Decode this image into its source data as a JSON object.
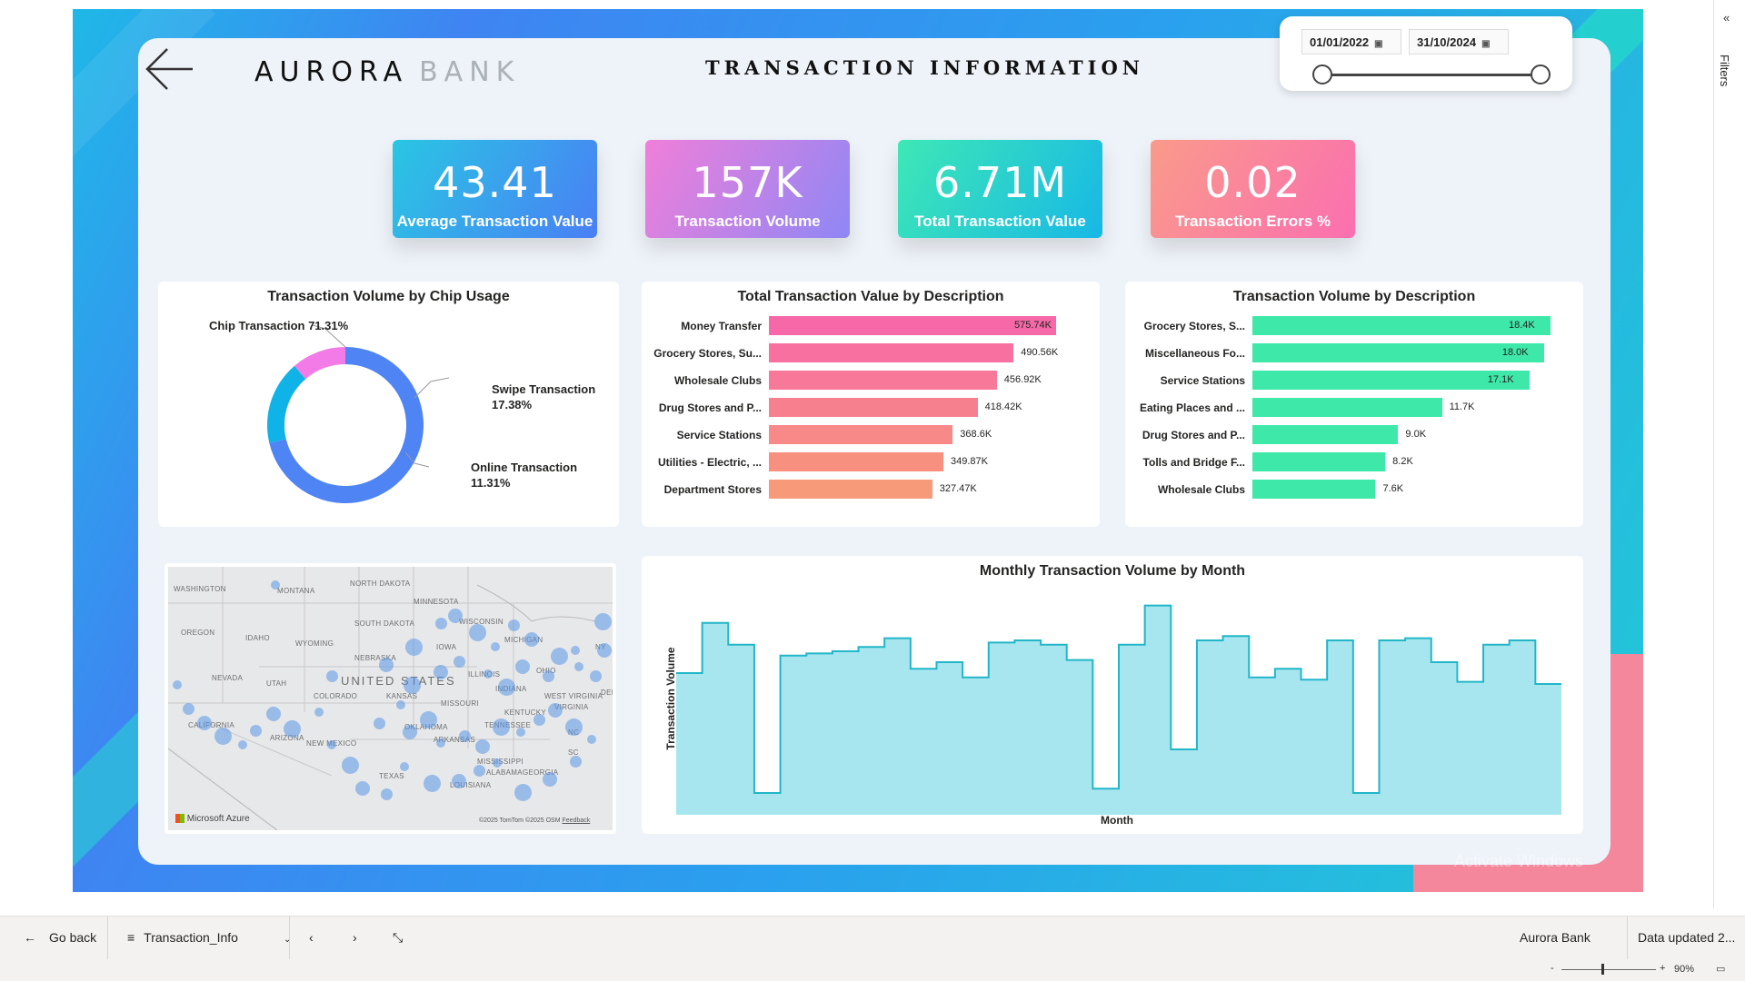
{
  "header": {
    "brand_primary": "AURORA",
    "brand_secondary": "BANK",
    "title": "TRANSACTION INFORMATION"
  },
  "date_slicer": {
    "start": "01/01/2022",
    "end": "31/10/2024"
  },
  "kpis": [
    {
      "value": "43.41",
      "label": "Average Transaction Value",
      "colors": [
        "#29c6e3",
        "#4a7ff5"
      ]
    },
    {
      "value": "157K",
      "label": "Transaction Volume",
      "colors": [
        "#f07fd9",
        "#8f87f5"
      ]
    },
    {
      "value": "6.71M",
      "label": "Total Transaction Value",
      "colors": [
        "#3ee8b5",
        "#17b8e6"
      ]
    },
    {
      "value": "0.02",
      "label": "Transaction Errors %",
      "colors": [
        "#f99a8a",
        "#fb6fb0"
      ]
    }
  ],
  "chip_usage": {
    "title": "Transaction Volume by Chip Usage",
    "chart_data": {
      "type": "pie",
      "categories": [
        "Chip Transaction",
        "Swipe Transaction",
        "Online Transaction"
      ],
      "values": [
        71.31,
        17.38,
        11.31
      ],
      "colors": [
        "#4f84f5",
        "#10b3e8",
        "#f27be7"
      ]
    },
    "labels": {
      "chip": "Chip Transaction 71.31%",
      "swipe_name": "Swipe Transaction",
      "swipe_pct": "17.38%",
      "online_name": "Online Transaction",
      "online_pct": "11.31%"
    }
  },
  "value_by_desc": {
    "title": "Total Transaction Value by Description",
    "chart_data": {
      "type": "bar",
      "categories": [
        "Money Transfer",
        "Grocery Stores, Su...",
        "Wholesale Clubs",
        "Drug Stores and P...",
        "Service Stations",
        "Utilities - Electric, ...",
        "Department Stores"
      ],
      "values": [
        575740,
        490560,
        456920,
        418420,
        368600,
        349870,
        327470
      ],
      "labels": [
        "575.74K",
        "490.56K",
        "456.92K",
        "418.42K",
        "368.6K",
        "349.87K",
        "327.47K"
      ],
      "colors": [
        "#f768a8",
        "#f7709f",
        "#f77898",
        "#f7808f",
        "#f78a88",
        "#f7907f",
        "#f79a7a"
      ],
      "max": 575740
    }
  },
  "volume_by_desc": {
    "title": "Transaction Volume by Description",
    "chart_data": {
      "type": "bar",
      "categories": [
        "Grocery Stores, S...",
        "Miscellaneous Fo...",
        "Service Stations",
        "Eating Places and ...",
        "Drug Stores and P...",
        "Tolls and Bridge F...",
        "Wholesale Clubs"
      ],
      "values": [
        18400,
        18000,
        17100,
        11700,
        9000,
        8200,
        7600
      ],
      "labels": [
        "18.4K",
        "18.0K",
        "17.1K",
        "11.7K",
        "9.0K",
        "8.2K",
        "7.6K"
      ],
      "color": "#3ee8a8",
      "max": 18400
    }
  },
  "map": {
    "states": [
      "WASHINGTON",
      "MONTANA",
      "NORTH DAKOTA",
      "MINNESOTA",
      "SOUTH DAKOTA",
      "WISCONSIN",
      "OREGON",
      "IDAHO",
      "WYOMING",
      "MICHIGAN",
      "NEBRASKA",
      "IOWA",
      "NEVADA",
      "UTAH",
      "UNITED STATES",
      "ILLINOIS",
      "OHIO",
      "COLORADO",
      "KANSAS",
      "MISSOURI",
      "INDIANA",
      "WEST VIRGINIA",
      "KENTUCKY",
      "VIRGINIA",
      "CALIFORNIA",
      "OKLAHOMA",
      "TENNESSEE",
      "ARIZONA",
      "NEW MEXICO",
      "ARKANSAS",
      "MISSISSIPPI",
      "ALABAMA",
      "GEORGIA",
      "TEXAS",
      "LOUISIANA",
      "SC",
      "NC",
      "NY",
      "DELA"
    ],
    "provider": "Microsoft Azure",
    "copyright": "©2025 TomTom  ©2025 OSM",
    "feedback": "Feedback"
  },
  "monthly": {
    "title": "Monthly Transaction Volume by Month",
    "xlabel": "Month",
    "ylabel": "Transaction Volume",
    "chart_data": {
      "type": "area",
      "values": [
        65,
        88,
        78,
        10,
        73,
        74,
        75,
        77,
        81,
        67,
        70,
        63,
        79,
        80,
        78,
        71,
        12,
        78,
        96,
        30,
        80,
        82,
        63,
        67,
        62,
        80,
        10,
        80,
        81,
        70,
        61,
        78,
        80,
        60
      ],
      "color": "#a8e6ef",
      "line_color": "#22b6c8"
    }
  },
  "bottombar": {
    "go_back": "Go back",
    "page": "Transaction_Info",
    "report_name": "Aurora Bank",
    "data_updated": "Data updated 2...",
    "zoom": "90%"
  },
  "filters_label": "Filters",
  "watermark": "Activate Windows"
}
